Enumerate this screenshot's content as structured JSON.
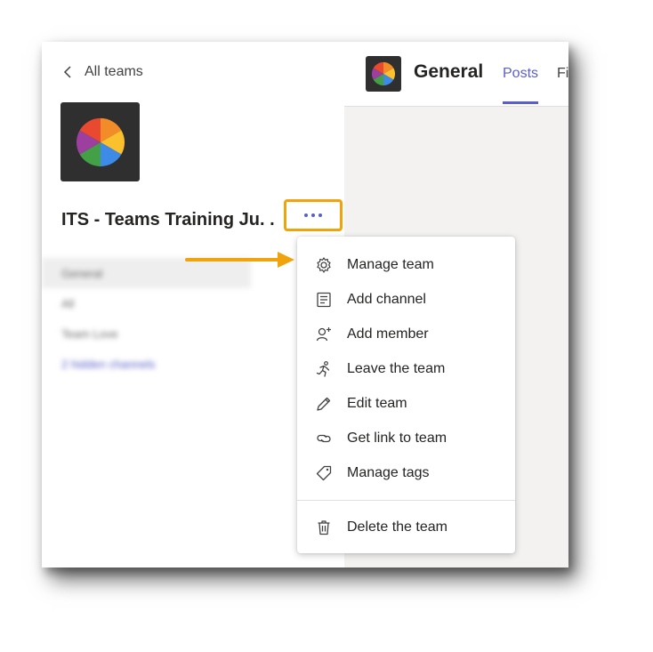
{
  "sidebar": {
    "back_label": "All teams",
    "team_name": "ITS - Teams Training Ju. .",
    "channels": [
      {
        "label": "General",
        "selected": true
      },
      {
        "label": "All",
        "selected": false
      },
      {
        "label": "Team Love",
        "selected": false
      },
      {
        "label": "2 hidden channels",
        "selected": false
      }
    ]
  },
  "header": {
    "channel_title": "General",
    "tabs": [
      {
        "label": "Posts",
        "active": true
      },
      {
        "label": "Fi",
        "active": false
      }
    ]
  },
  "menu": {
    "items": [
      {
        "label": "Manage team",
        "icon": "gear-icon"
      },
      {
        "label": "Add channel",
        "icon": "channel-list-icon"
      },
      {
        "label": "Add member",
        "icon": "add-person-icon"
      },
      {
        "label": "Leave the team",
        "icon": "leave-runner-icon"
      },
      {
        "label": "Edit team",
        "icon": "pencil-icon"
      },
      {
        "label": "Get link to team",
        "icon": "link-icon"
      },
      {
        "label": "Manage tags",
        "icon": "tag-icon"
      },
      {
        "label": "Delete the team",
        "icon": "trash-icon"
      }
    ]
  },
  "colors": {
    "accent": "#5b5fc7",
    "highlight": "#f0a30a",
    "pie": [
      "#e9492f",
      "#f28c28",
      "#fbc02d",
      "#3d8be6",
      "#43a047",
      "#9c3f9e"
    ]
  }
}
